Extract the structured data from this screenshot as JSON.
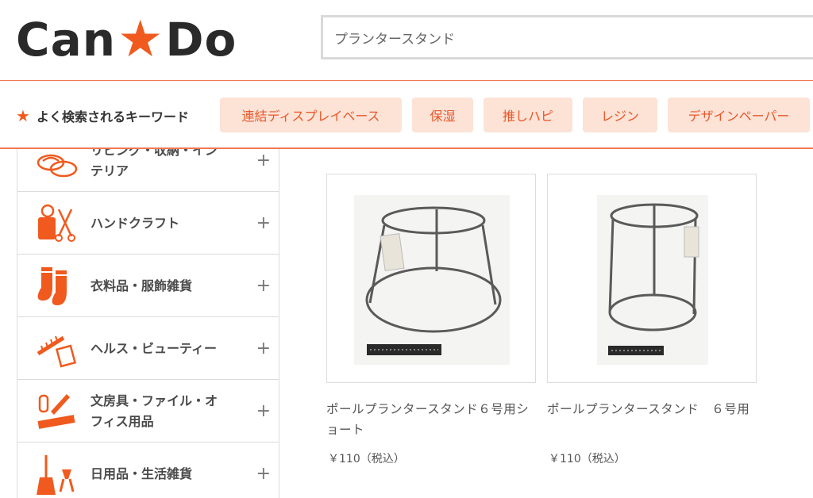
{
  "header": {
    "logo_left": "Can",
    "logo_right": "Do",
    "search_value": "プランタースタンド"
  },
  "keywords": {
    "label": "よく検索されるキーワード",
    "tags": [
      "連結ディスプレイベース",
      "保湿",
      "推しハピ",
      "レジン",
      "デザインペーパー"
    ]
  },
  "sidebar": {
    "items": [
      {
        "label": "リビング・収納・イン\nテリア",
        "icon": "slippers-icon"
      },
      {
        "label": "ハンドクラフト",
        "icon": "sewing-icon"
      },
      {
        "label": "衣料品・服飾雑貨",
        "icon": "socks-icon"
      },
      {
        "label": "ヘルス・ビューティー",
        "icon": "comb-mirror-icon"
      },
      {
        "label": "文房具・ファイル・オ\nフィス用品",
        "icon": "stationery-icon"
      },
      {
        "label": "日用品・生活雑貨",
        "icon": "broom-icon"
      }
    ],
    "expand_symbol": "+"
  },
  "products": [
    {
      "name": "ポールプランタースタンド６号用ショート",
      "price": "￥110（税込）"
    },
    {
      "name": "ポールプランタースタンド　６号用",
      "price": "￥110（税込）"
    }
  ],
  "colors": {
    "accent": "#f05a1e",
    "tag_bg": "#fde2d6",
    "tag_text": "#e8582a"
  }
}
